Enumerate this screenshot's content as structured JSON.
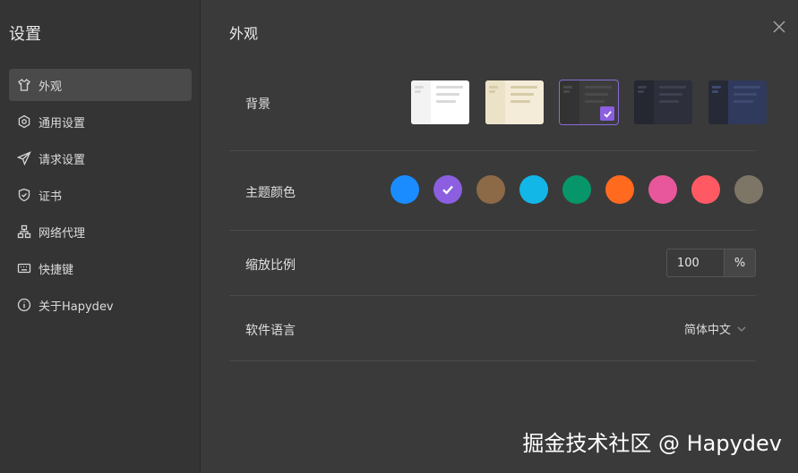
{
  "sidebar": {
    "title": "设置",
    "items": [
      {
        "label": "外观",
        "icon": "shirt-icon",
        "active": true
      },
      {
        "label": "通用设置",
        "icon": "hexagon-gear-icon",
        "active": false
      },
      {
        "label": "请求设置",
        "icon": "send-icon",
        "active": false
      },
      {
        "label": "证书",
        "icon": "shield-check-icon",
        "active": false
      },
      {
        "label": "网络代理",
        "icon": "network-icon",
        "active": false
      },
      {
        "label": "快捷键",
        "icon": "keyboard-icon",
        "active": false
      },
      {
        "label": "关于Hapydev",
        "icon": "info-icon",
        "active": false
      }
    ]
  },
  "main": {
    "title": "外观",
    "background": {
      "label": "背景",
      "themes": [
        {
          "name": "white",
          "bg": "#ffffff",
          "side": "#f3f3f3",
          "line": "#dadada",
          "selected": false
        },
        {
          "name": "beige",
          "bg": "#f4ecd8",
          "side": "#ece2c8",
          "line": "#d8cba8",
          "selected": false
        },
        {
          "name": "dark",
          "bg": "#3c3c3c",
          "side": "#333333",
          "line": "#4a4a4a",
          "selected": true
        },
        {
          "name": "navy-dark",
          "bg": "#2d2f3a",
          "side": "#252731",
          "line": "#3d4050",
          "selected": false
        },
        {
          "name": "blue-dark",
          "bg": "#303a5c",
          "side": "#262a36",
          "line": "#3e4a70",
          "selected": false
        }
      ]
    },
    "theme_color": {
      "label": "主题颜色",
      "colors": [
        "#1a8cff",
        "#8b5fe0",
        "#8c6a48",
        "#12b7e8",
        "#079669",
        "#ff6a1f",
        "#e8579b",
        "#ff5a64",
        "#7d7566"
      ],
      "selected_index": 1
    },
    "zoom": {
      "label": "缩放比例",
      "value": "100",
      "unit": "%"
    },
    "language": {
      "label": "软件语言",
      "value": "简体中文"
    }
  },
  "watermark": "掘金技术社区 @ Hapydev"
}
